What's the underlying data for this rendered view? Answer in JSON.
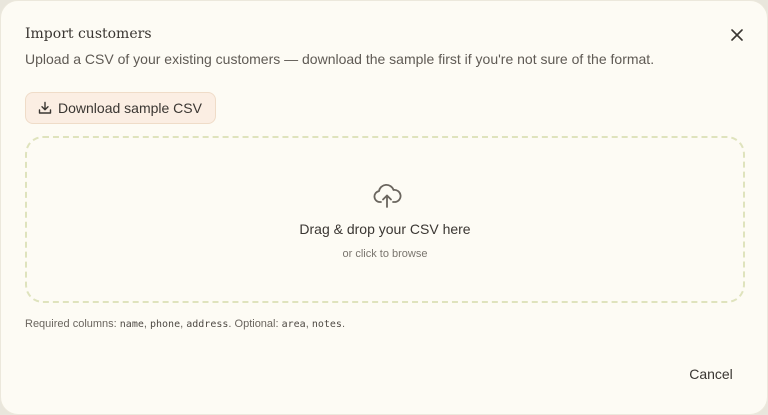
{
  "dialog": {
    "title": "Import customers",
    "subtitle": "Upload a CSV of your existing customers — download the sample first if you're not sure of the format.",
    "close_icon": "close-icon"
  },
  "download": {
    "label": "Download sample CSV",
    "icon": "download-icon"
  },
  "dropzone": {
    "title": "Drag & drop your CSV here",
    "subtitle": "or click to browse",
    "icon": "cloud-upload-icon"
  },
  "hint": {
    "required_label": "Required columns:",
    "required_columns": [
      "name",
      "phone",
      "address"
    ],
    "optional_label": "Optional:",
    "optional_columns": [
      "area",
      "notes"
    ]
  },
  "footer": {
    "cancel_label": "Cancel"
  },
  "colors": {
    "dialog_bg": "#fdfbf4",
    "button_bg": "#fbeee3",
    "dropzone_border": "#dfe3bd",
    "text": "#3a3632"
  }
}
